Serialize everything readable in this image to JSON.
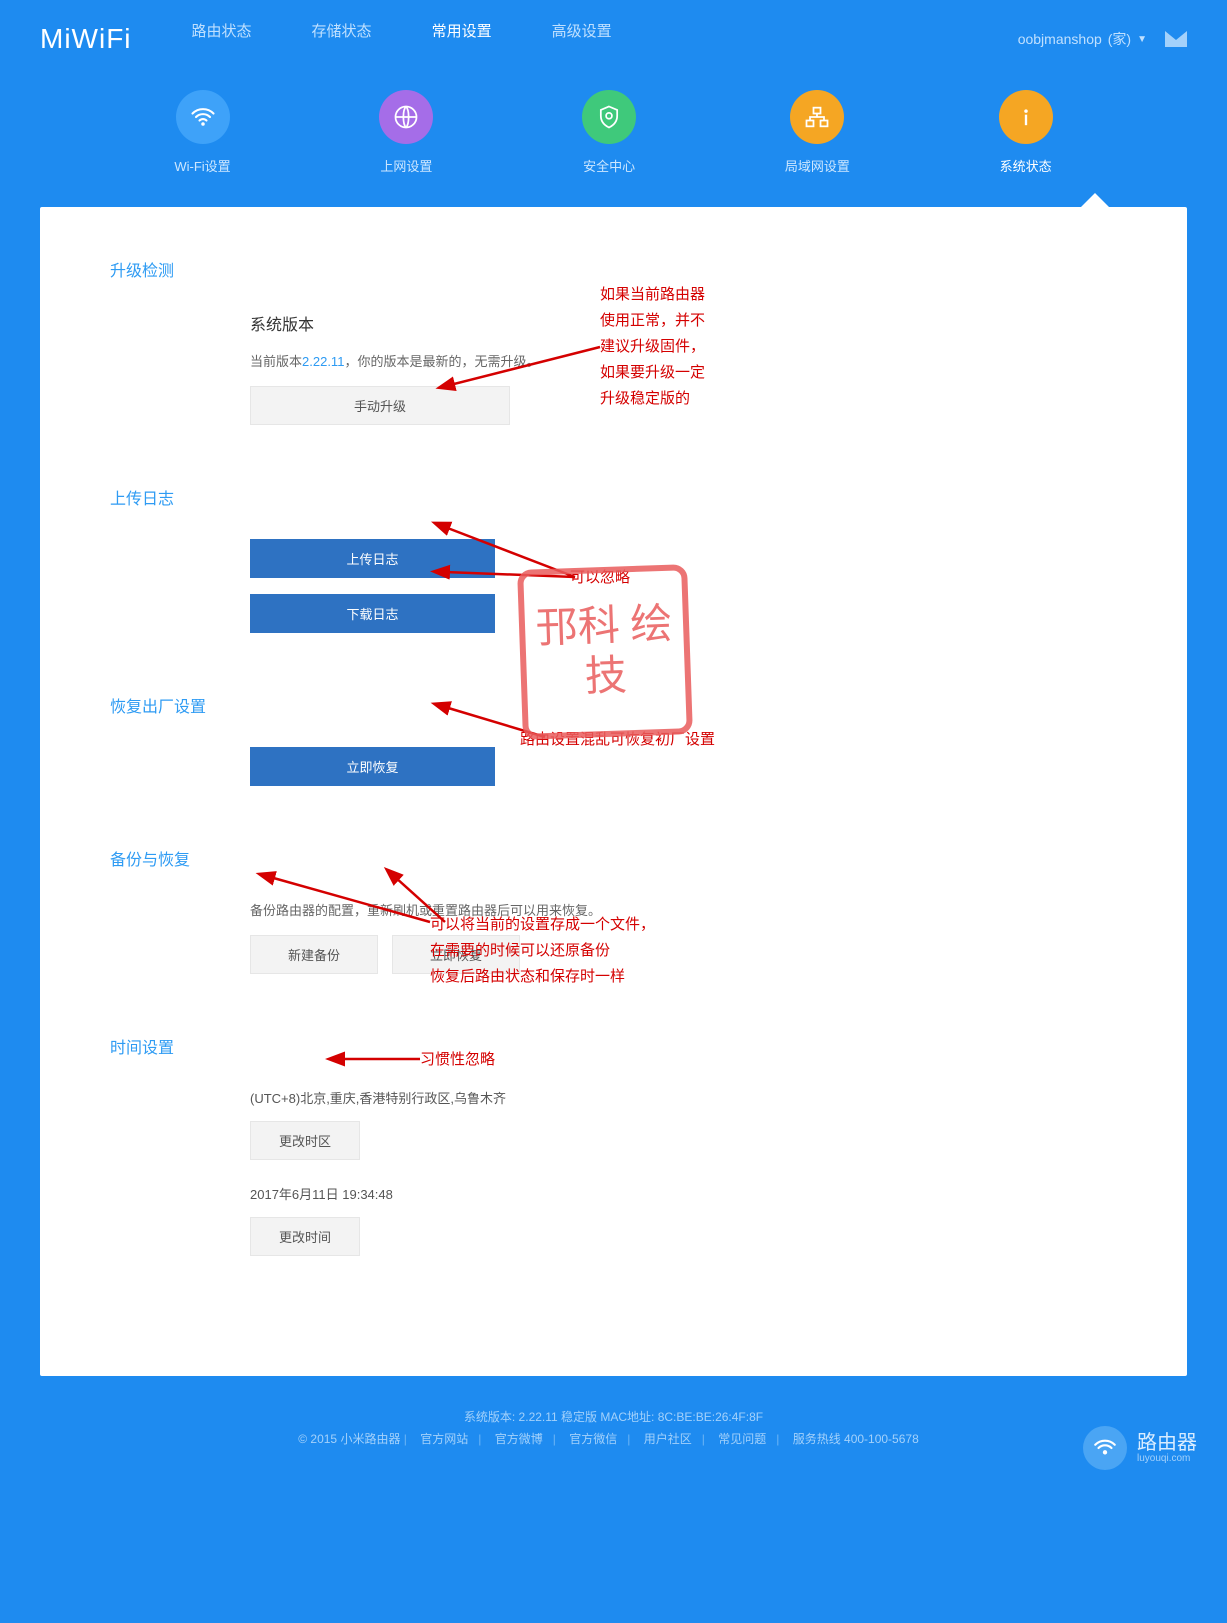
{
  "logo": "MiWiFi",
  "nav": {
    "status": "路由状态",
    "storage": "存储状态",
    "common": "常用设置",
    "advanced": "高级设置"
  },
  "user": {
    "name": "oobjmanshop",
    "tag": "(家)"
  },
  "subnav": {
    "wifi": "Wi-Fi设置",
    "internet": "上网设置",
    "security": "安全中心",
    "lan": "局域网设置",
    "system": "系统状态"
  },
  "sections": {
    "upgrade": {
      "title": "升级检测",
      "sub_title": "系统版本",
      "desc_prefix": "当前版本",
      "version": "2.22.11",
      "desc_suffix": "，你的版本是最新的，无需升级。",
      "manual_btn": "手动升级"
    },
    "log": {
      "title": "上传日志",
      "upload_btn": "上传日志",
      "download_btn": "下载日志"
    },
    "factory": {
      "title": "恢复出厂设置",
      "restore_btn": "立即恢复"
    },
    "backup": {
      "title": "备份与恢复",
      "desc": "备份路由器的配置，重新刷机或重置路由器后可以用来恢复。",
      "new_btn": "新建备份",
      "restore_btn": "立即恢复"
    },
    "time": {
      "title": "时间设置",
      "tz_info": "(UTC+8)北京,重庆,香港特别行政区,乌鲁木齐",
      "tz_btn": "更改时区",
      "current_time": "2017年6月11日 19:34:48",
      "time_btn": "更改时间"
    }
  },
  "annot": {
    "a1": "如果当前路由器\n使用正常，并不\n建议升级固件，\n如果要升级一定\n升级稳定版的",
    "a2": "可以忽略",
    "a3": "路由设置混乱可恢复初厂设置",
    "a4": "可以将当前的设置存成一个文件，\n在需要的时候可以还原备份\n恢复后路由状态和保存时一样",
    "a5": "习惯性忽略",
    "stamp": "邘科\n绘技"
  },
  "footer": {
    "line1": "系统版本: 2.22.11 稳定版  MAC地址: 8C:BE:BE:26:4F:8F",
    "copyright": "© 2015 小米路由器",
    "links": [
      "官方网站",
      "官方微博",
      "官方微信",
      "用户社区",
      "常见问题",
      "服务热线 400-100-5678"
    ]
  },
  "badge": {
    "title": "路由器",
    "sub": "luyouqi.com"
  }
}
